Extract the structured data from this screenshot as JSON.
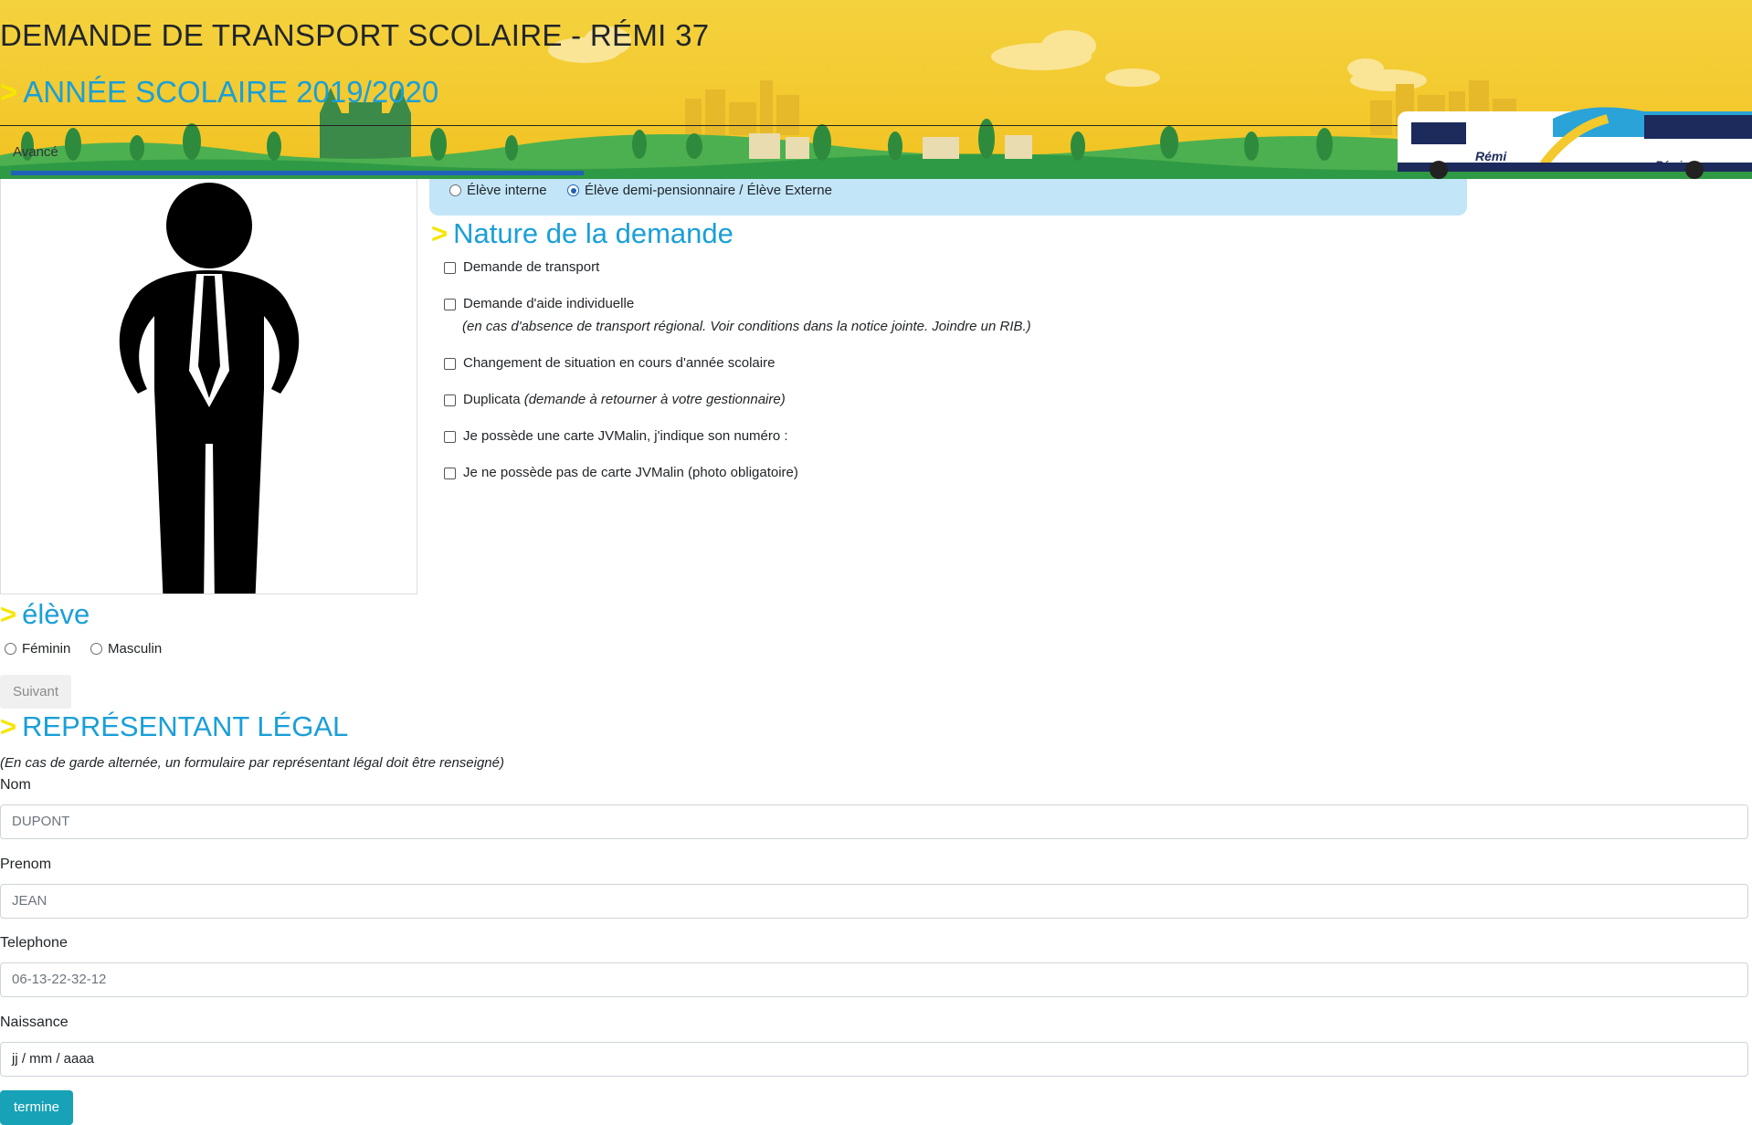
{
  "header": {
    "title": "DEMANDE DE TRANSPORT SCOLAIRE - RÉMI 37",
    "subtitle": "ANNÉE SCOLAIRE 2019/2020",
    "chevron": ">",
    "progress_label": "Avancé",
    "progress_fraction": 0.33,
    "bus_logo": "Rémi"
  },
  "regime": {
    "options": [
      "Élève interne",
      "Élève demi-pensionnaire / Élève Externe"
    ],
    "selected": 1
  },
  "nature": {
    "title": "Nature de la demande",
    "items": [
      {
        "label": "Demande de transport",
        "note": ""
      },
      {
        "label": "Demande d'aide individuelle",
        "note": "(en cas d'absence de transport régional. Voir conditions dans la notice jointe. Joindre un RIB.)"
      },
      {
        "label": "Changement de situation en cours d'année scolaire",
        "note": ""
      },
      {
        "label": "Duplicata ",
        "note": "(demande à retourner à votre gestionnaire)"
      },
      {
        "label": "Je possède une carte JVMalin, j'indique son numéro :",
        "note": ""
      },
      {
        "label": "Je ne possède pas de carte JVMalin (photo obligatoire)",
        "note": ""
      }
    ]
  },
  "eleve": {
    "title": "élève",
    "gender_options": [
      "Féminin",
      "Masculin"
    ],
    "next_button": "Suivant"
  },
  "representant": {
    "title": "REPRÉSENTANT LÉGAL",
    "note": "(En cas de garde alternée, un formulaire par représentant légal doit être renseigné)",
    "fields": [
      {
        "label": "Nom",
        "placeholder": "DUPONT"
      },
      {
        "label": "Prenom",
        "placeholder": "JEAN"
      },
      {
        "label": "Telephone",
        "placeholder": "06-13-22-32-12"
      },
      {
        "label": "Naissance",
        "placeholder": "jj / mm / aaaa"
      }
    ],
    "submit_button": "termine"
  },
  "colors": {
    "accent_blue": "#1a9fd8",
    "chevron_yellow": "#f6e600",
    "banner_yellow": "#f3c92e",
    "regime_bg": "#c2e6f8",
    "progress_blue": "#1f62b8",
    "submit_teal": "#17a2b8"
  }
}
